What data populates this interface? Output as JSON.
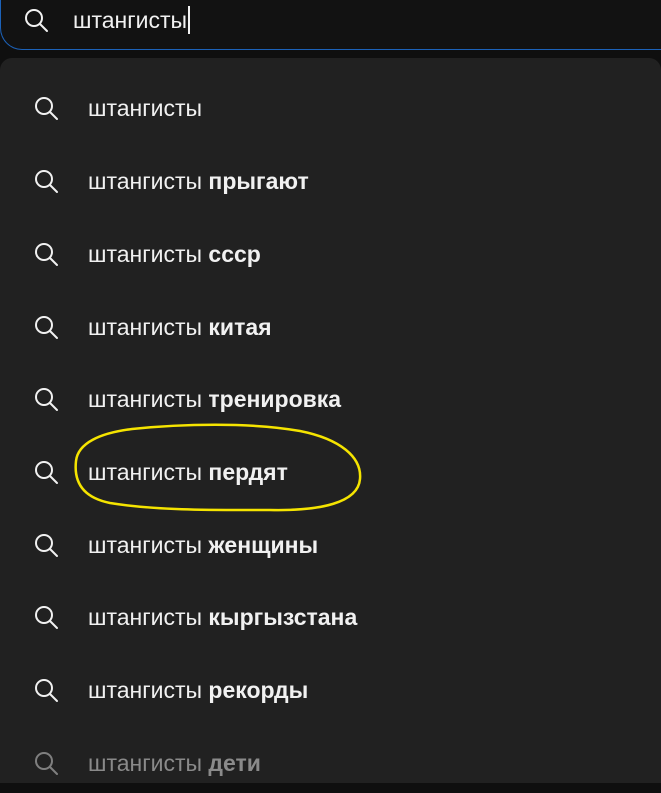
{
  "search": {
    "query": "штангисты",
    "icon": "search-icon"
  },
  "suggestions": [
    {
      "prefix": "штангисты",
      "suffix": ""
    },
    {
      "prefix": "штангисты",
      "suffix": " прыгают"
    },
    {
      "prefix": "штангисты",
      "suffix": " ссср"
    },
    {
      "prefix": "штангисты",
      "suffix": " китая"
    },
    {
      "prefix": "штангисты",
      "suffix": " тренировка"
    },
    {
      "prefix": "штангисты",
      "suffix": " пердят"
    },
    {
      "prefix": "штангисты",
      "suffix": " женщины"
    },
    {
      "prefix": "штангисты",
      "suffix": " кыргызстана"
    },
    {
      "prefix": "штангисты",
      "suffix": " рекорды"
    },
    {
      "prefix": "штангисты",
      "suffix": " дети"
    }
  ],
  "colors": {
    "background": "#212121",
    "text": "#f1f1f1",
    "focus_border": "#1c62b9",
    "highlight_ring": "#f5e400"
  }
}
